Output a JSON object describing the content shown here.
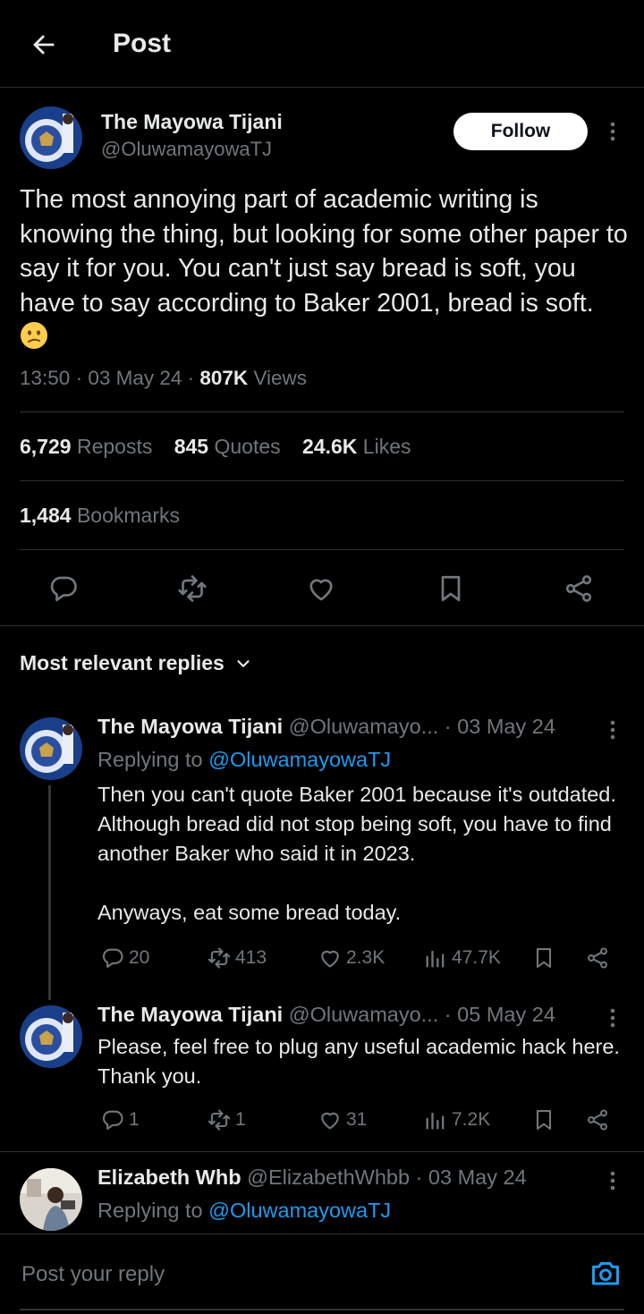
{
  "header": {
    "title": "Post"
  },
  "post": {
    "author_name": "The Mayowa Tijani",
    "author_handle": "@OluwamayowaTJ",
    "follow_label": "Follow",
    "text": "The most annoying part of academic writing is knowing the thing, but looking for some other paper to say it for you. You can't just say bread is soft, you have to say according to Baker 2001, bread is soft.",
    "emoji": "confused-face-emoji",
    "time": "13:50",
    "date": "03 May 24",
    "views_count": "807K",
    "views_label": "Views",
    "reposts_count": "6,729",
    "reposts_label": "Reposts",
    "quotes_count": "845",
    "quotes_label": "Quotes",
    "likes_count": "24.6K",
    "likes_label": "Likes",
    "bookmarks_count": "1,484",
    "bookmarks_label": "Bookmarks"
  },
  "replies_filter": {
    "label": "Most relevant replies"
  },
  "replies": [
    {
      "author_name": "The Mayowa Tijani",
      "author_handle": "@Oluwamayo...",
      "date": "· 03 May 24",
      "replying_prefix": "Replying to",
      "replying_to": "@OluwamayowaTJ",
      "text": "Then you can't quote Baker 2001 because it's outdated. Although bread did not stop being soft, you have to find another Baker who said it in 2023.\n\nAnyways, eat some bread today.",
      "replies": "20",
      "reposts": "413",
      "likes": "2.3K",
      "views": "47.7K"
    },
    {
      "author_name": "The Mayowa Tijani",
      "author_handle": "@Oluwamayo...",
      "date": "· 05 May 24",
      "text": "Please, feel free to plug any useful academic hack here. Thank you.",
      "replies": "1",
      "reposts": "1",
      "likes": "31",
      "views": "7.2K"
    },
    {
      "author_name": "Elizabeth Whb",
      "author_handle": "@ElizabethWhbb",
      "date": "· 03 May 24",
      "replying_prefix": "Replying to",
      "replying_to": "@OluwamayowaTJ"
    }
  ],
  "composer": {
    "placeholder": "Post your reply"
  },
  "colors": {
    "background": "#000000",
    "text": "#e7e9ea",
    "secondary": "#71767b",
    "accent": "#1d9bf0",
    "divider": "#2f3336"
  }
}
